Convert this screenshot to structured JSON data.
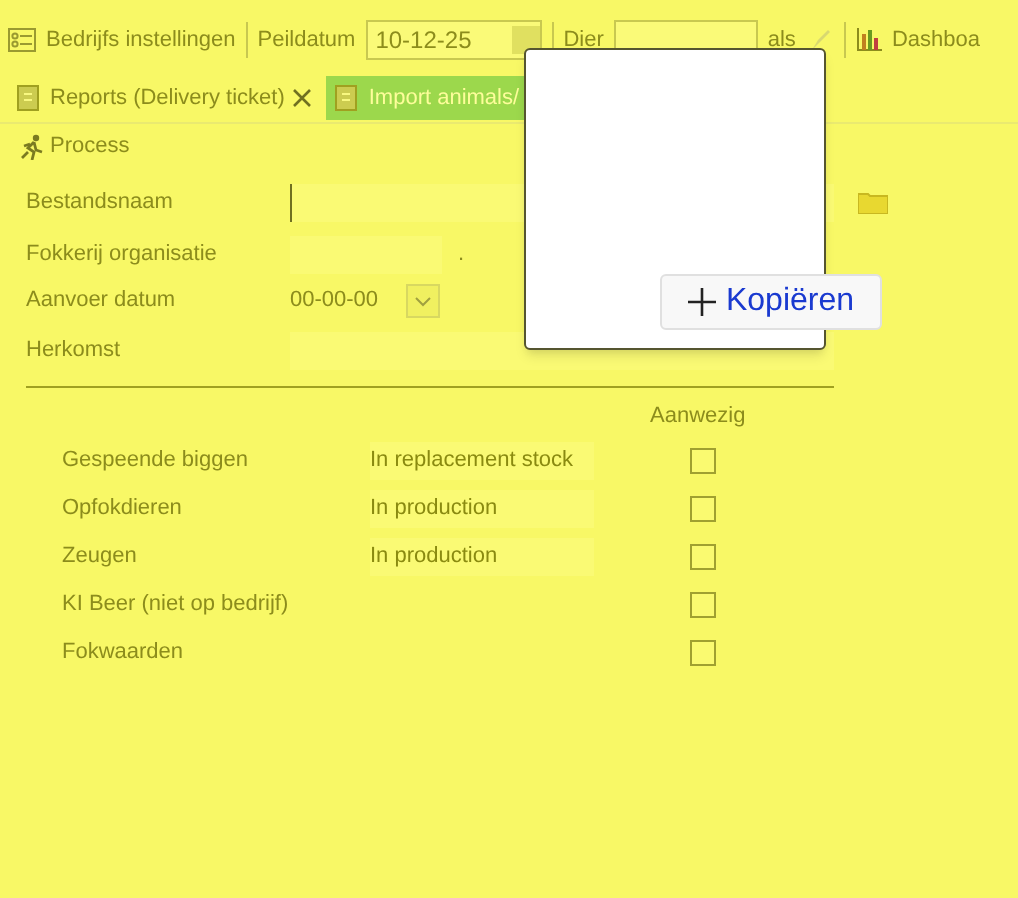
{
  "toolbar": {
    "settings": "Bedrijfs instellingen",
    "date_label": "Peildatum",
    "date_value": "10-12-25",
    "animal_label": "Dier",
    "as_label": "als",
    "dashboard": "Dashboa"
  },
  "tabs": [
    {
      "label": "Reports (Delivery ticket)",
      "selected": false
    },
    {
      "label": "Import animals/",
      "selected": true
    }
  ],
  "process_button": "Process",
  "form": {
    "filename_label": "Bestandsnaam",
    "org_label": "Fokkerij organisatie",
    "org_dot": ".",
    "date_label": "Aanvoer datum",
    "date_value": "00-00-00",
    "origin_label": "Herkomst"
  },
  "popup": {
    "button": "Kopiëren"
  },
  "presence": {
    "header": "Aanwezig",
    "rows": [
      {
        "label": "Gespeende biggen",
        "status": "In replacement stock",
        "checked": false
      },
      {
        "label": "Opfokdieren",
        "status": "In production",
        "checked": false
      },
      {
        "label": "Zeugen",
        "status": "In production",
        "checked": false
      },
      {
        "label": "KI Beer (niet op bedrijf)",
        "checked": false
      },
      {
        "label": "Fokwaarden",
        "checked": false
      }
    ]
  }
}
